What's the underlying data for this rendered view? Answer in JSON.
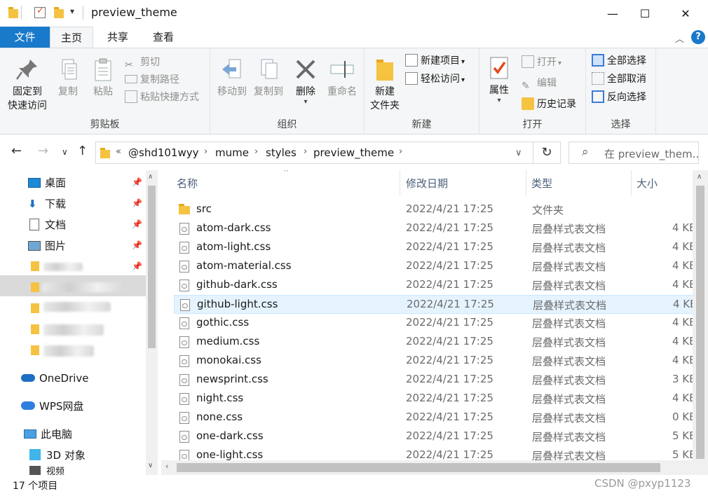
{
  "window": {
    "title": "preview_theme",
    "controls": {
      "minimize": "—",
      "maximize": "☐",
      "close": "✕"
    }
  },
  "ribbon_tabs": [
    "文件",
    "主页",
    "共享",
    "查看"
  ],
  "ribbon": {
    "clipboard": {
      "group_label": "剪贴板",
      "pin": [
        "固定到",
        "快速访问"
      ],
      "copy": "复制",
      "paste": "粘贴",
      "cut": "剪切",
      "copy_path": "复制路径",
      "paste_shortcut": "粘贴快捷方式"
    },
    "organize": {
      "group_label": "组织",
      "move_to": "移动到",
      "copy_to": "复制到",
      "delete": "删除",
      "rename": "重命名"
    },
    "new": {
      "group_label": "新建",
      "new_folder": [
        "新建",
        "文件夹"
      ],
      "new_item": "新建项目",
      "easy_access": "轻松访问"
    },
    "open": {
      "group_label": "打开",
      "properties": "属性",
      "open": "打开",
      "edit": "编辑",
      "history": "历史记录"
    },
    "select": {
      "group_label": "选择",
      "select_all": "全部选择",
      "select_none": "全部取消",
      "invert": "反向选择"
    }
  },
  "address": {
    "overflow": "«",
    "segments": [
      "@shd101wyy",
      "mume",
      "styles",
      "preview_theme"
    ],
    "search_placeholder": "在 preview_them..."
  },
  "nav_pane": {
    "quick_access": [
      {
        "label": "桌面",
        "icon": "desktop-icon"
      },
      {
        "label": "下载",
        "icon": "download-icon"
      },
      {
        "label": "文档",
        "icon": "documents-icon"
      },
      {
        "label": "图片",
        "icon": "pictures-icon"
      }
    ],
    "onedrive": "OneDrive",
    "wps": "WPS网盘",
    "this_pc": "此电脑",
    "objects_3d": "3D 对象",
    "video": "视频"
  },
  "columns": {
    "name": "名称",
    "date": "修改日期",
    "type": "类型",
    "size": "大小"
  },
  "files": [
    {
      "name": "src",
      "date": "2022/4/21 17:25",
      "type": "文件夹",
      "size": "",
      "kind": "folder"
    },
    {
      "name": "atom-dark.css",
      "date": "2022/4/21 17:25",
      "type": "层叠样式表文档",
      "size": "4 KB",
      "kind": "css"
    },
    {
      "name": "atom-light.css",
      "date": "2022/4/21 17:25",
      "type": "层叠样式表文档",
      "size": "4 KB",
      "kind": "css"
    },
    {
      "name": "atom-material.css",
      "date": "2022/4/21 17:25",
      "type": "层叠样式表文档",
      "size": "4 KB",
      "kind": "css"
    },
    {
      "name": "github-dark.css",
      "date": "2022/4/21 17:25",
      "type": "层叠样式表文档",
      "size": "4 KB",
      "kind": "css"
    },
    {
      "name": "github-light.css",
      "date": "2022/4/21 17:25",
      "type": "层叠样式表文档",
      "size": "4 KB",
      "kind": "css"
    },
    {
      "name": "gothic.css",
      "date": "2022/4/21 17:25",
      "type": "层叠样式表文档",
      "size": "4 KB",
      "kind": "css"
    },
    {
      "name": "medium.css",
      "date": "2022/4/21 17:25",
      "type": "层叠样式表文档",
      "size": "4 KB",
      "kind": "css"
    },
    {
      "name": "monokai.css",
      "date": "2022/4/21 17:25",
      "type": "层叠样式表文档",
      "size": "4 KB",
      "kind": "css"
    },
    {
      "name": "newsprint.css",
      "date": "2022/4/21 17:25",
      "type": "层叠样式表文档",
      "size": "3 KB",
      "kind": "css"
    },
    {
      "name": "night.css",
      "date": "2022/4/21 17:25",
      "type": "层叠样式表文档",
      "size": "4 KB",
      "kind": "css"
    },
    {
      "name": "none.css",
      "date": "2022/4/21 17:25",
      "type": "层叠样式表文档",
      "size": "0 KB",
      "kind": "css"
    },
    {
      "name": "one-dark.css",
      "date": "2022/4/21 17:25",
      "type": "层叠样式表文档",
      "size": "5 KB",
      "kind": "css"
    },
    {
      "name": "one-light.css",
      "date": "2022/4/21 17:25",
      "type": "层叠样式表文档",
      "size": "5 KB",
      "kind": "css"
    }
  ],
  "highlighted_file": "github-light.css",
  "status": {
    "item_count": "17 个项目",
    "watermark": "CSDN @pxyp1123"
  },
  "colors": {
    "accent": "#1979ca",
    "folder": "#f5c242",
    "hover_row": "#e5f3ff"
  }
}
